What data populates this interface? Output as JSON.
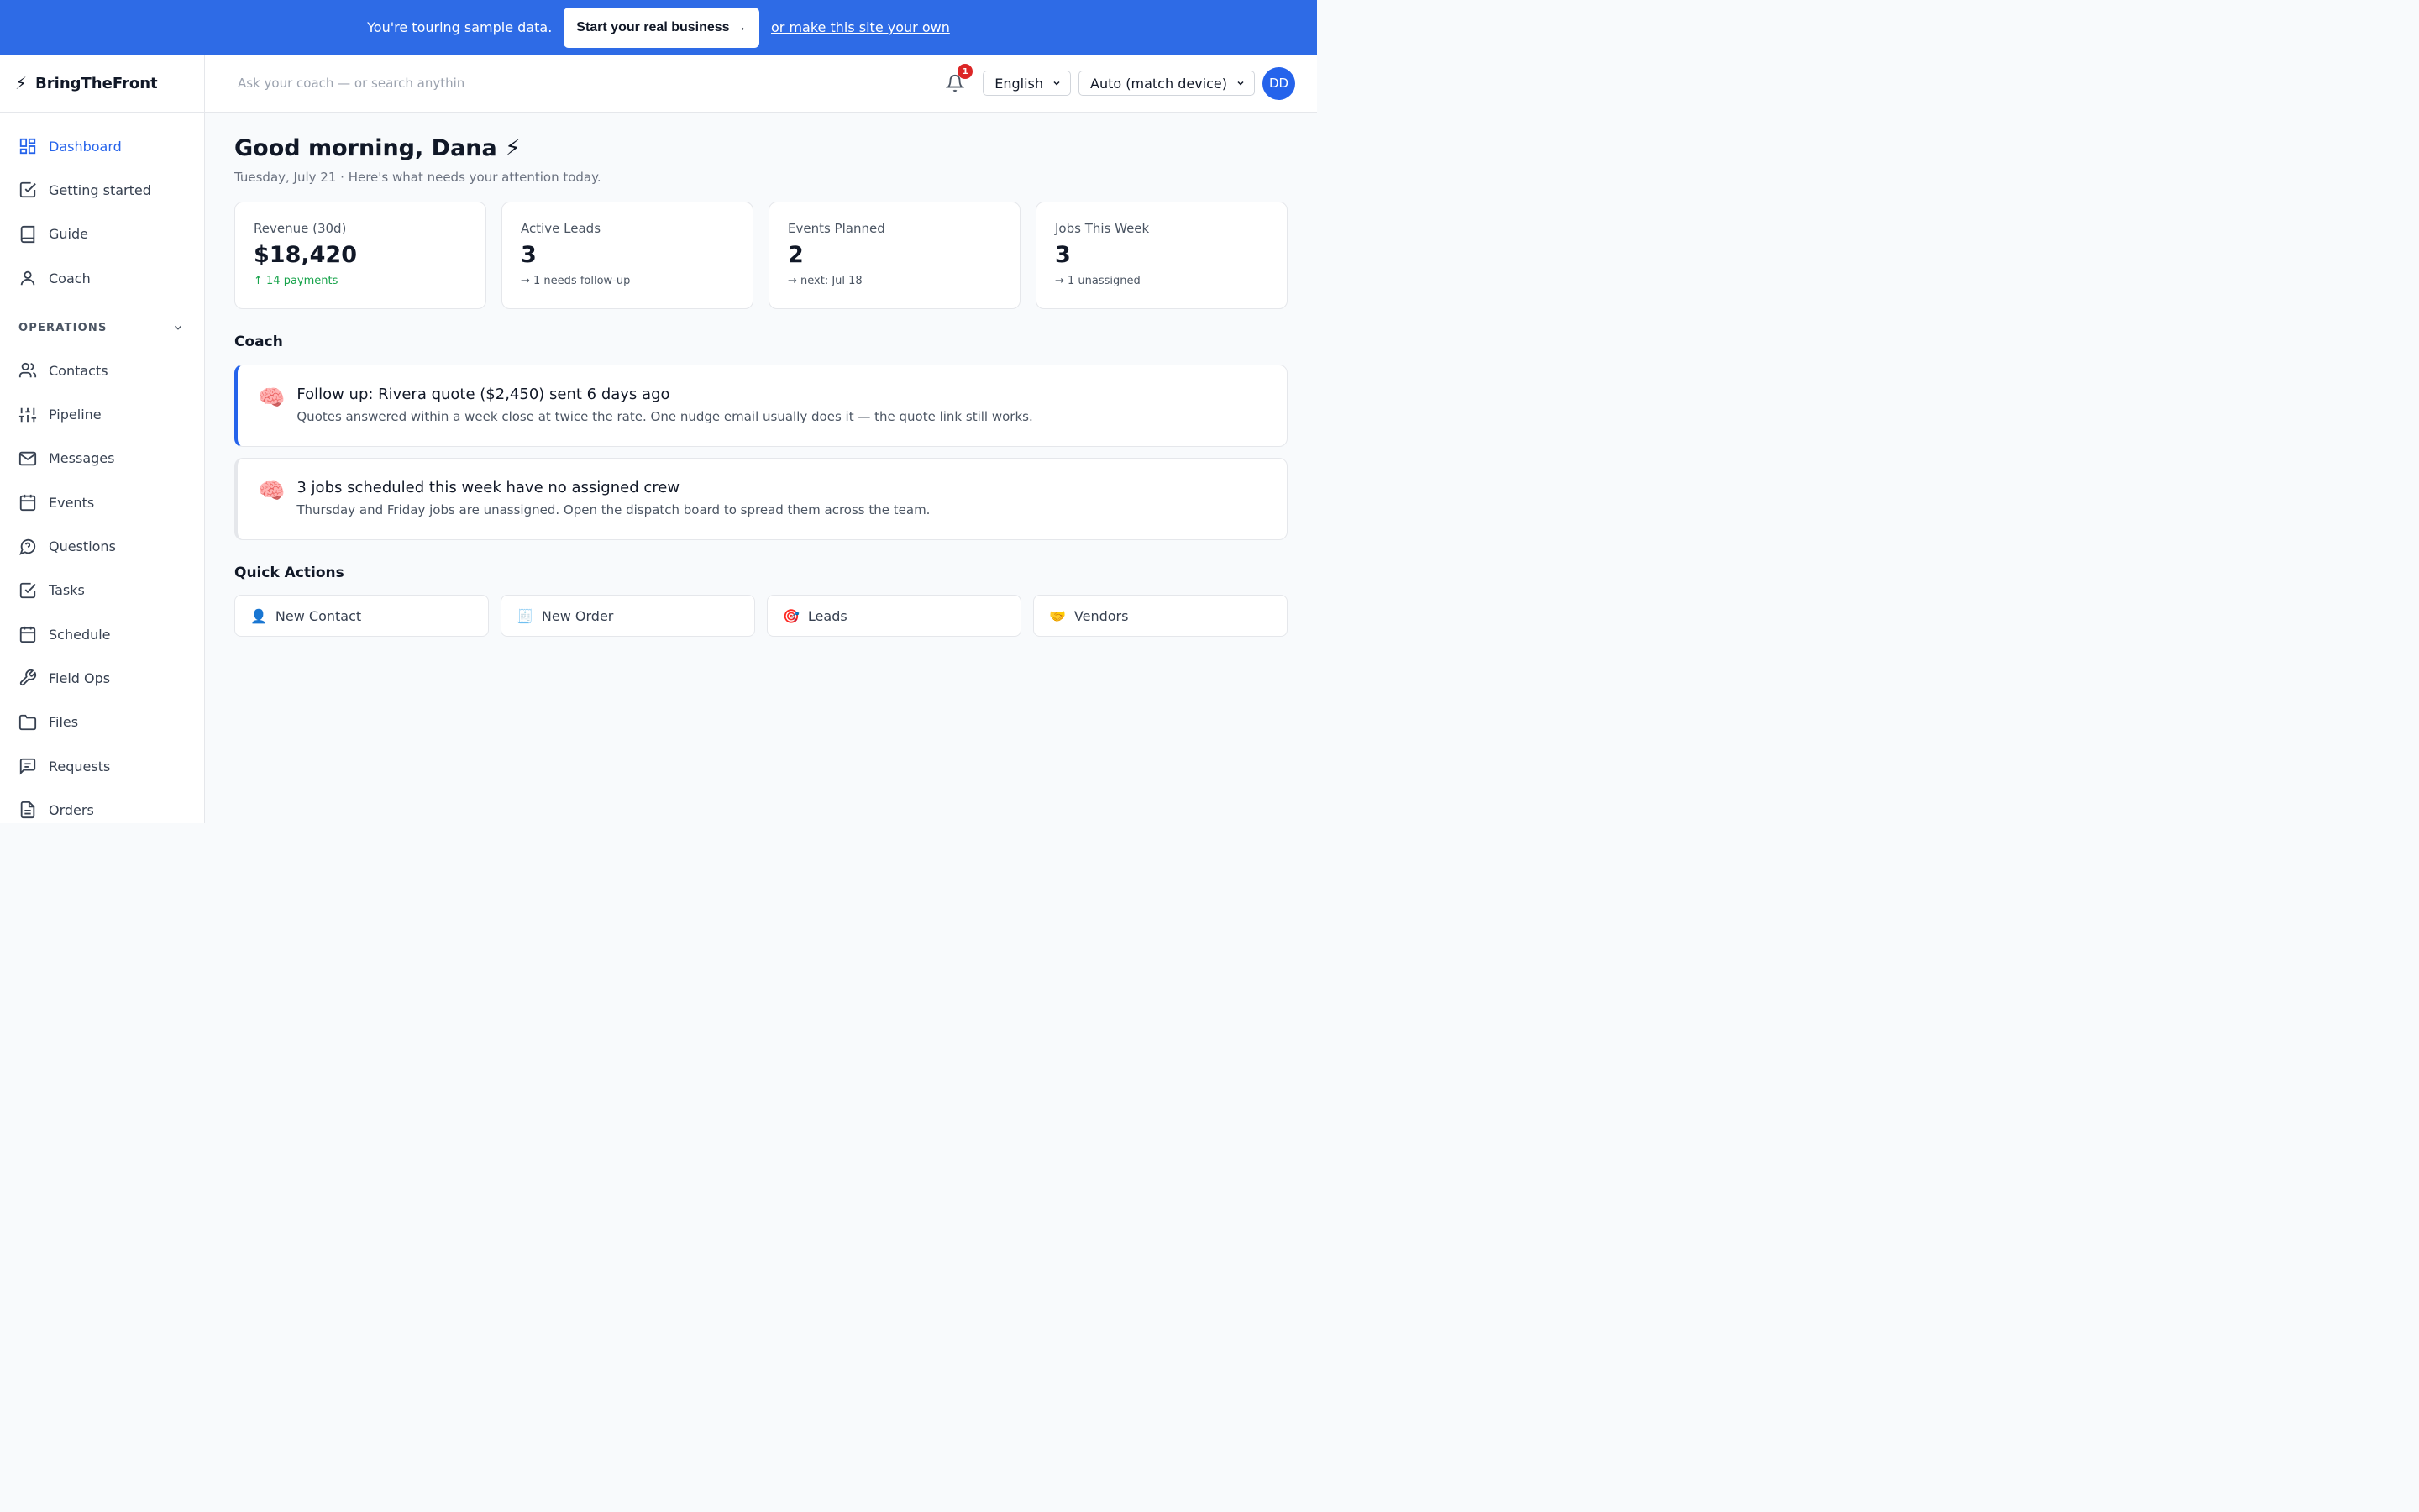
{
  "banner": {
    "text": "You're touring sample data.",
    "cta": "Start your real business →",
    "link": "or make this site your own"
  },
  "brand": {
    "icon": "⚡",
    "name": "BringTheFront"
  },
  "nav": {
    "top": [
      {
        "label": "Dashboard",
        "icon": "dashboard-icon"
      },
      {
        "label": "Getting started",
        "icon": "checkbox-icon"
      },
      {
        "label": "Guide",
        "icon": "book-icon"
      },
      {
        "label": "Coach",
        "icon": "user-icon"
      }
    ],
    "section_label": "OPERATIONS",
    "ops": [
      {
        "label": "Contacts",
        "icon": "users-icon"
      },
      {
        "label": "Pipeline",
        "icon": "sliders-icon"
      },
      {
        "label": "Messages",
        "icon": "mail-icon"
      },
      {
        "label": "Events",
        "icon": "calendar-icon"
      },
      {
        "label": "Questions",
        "icon": "help-icon"
      },
      {
        "label": "Tasks",
        "icon": "checkbox-icon"
      },
      {
        "label": "Schedule",
        "icon": "calendar-icon"
      },
      {
        "label": "Field Ops",
        "icon": "wrench-icon"
      },
      {
        "label": "Files",
        "icon": "folder-icon"
      },
      {
        "label": "Requests",
        "icon": "message-square-icon"
      },
      {
        "label": "Orders",
        "icon": "file-icon"
      }
    ]
  },
  "topbar": {
    "search_placeholder": "Ask your coach — or search anythin",
    "notification_count": "1",
    "language": "English",
    "theme": "Auto (match device)",
    "avatar_initials": "DD"
  },
  "greeting": {
    "title": "Good morning, Dana ⚡",
    "subtitle": "Tuesday, July 21 · Here's what needs your attention today."
  },
  "stats": [
    {
      "label": "Revenue (30d)",
      "value": "$18,420",
      "sub": "↑ 14 payments",
      "trend": "up"
    },
    {
      "label": "Active Leads",
      "value": "3",
      "sub": "→ 1 needs follow-up",
      "trend": "neutral"
    },
    {
      "label": "Events Planned",
      "value": "2",
      "sub": "→ next: Jul 18",
      "trend": "neutral"
    },
    {
      "label": "Jobs This Week",
      "value": "3",
      "sub": "→ 1 unassigned",
      "trend": "neutral"
    }
  ],
  "coach": {
    "title": "Coach",
    "cards": [
      {
        "emoji": "🧠",
        "heading": "Follow up: Rivera quote ($2,450) sent 6 days ago",
        "body": "Quotes answered within a week close at twice the rate. One nudge email usually does it — the quote link still works."
      },
      {
        "emoji": "🧠",
        "heading": "3 jobs scheduled this week have no assigned crew",
        "body": "Thursday and Friday jobs are unassigned. Open the dispatch board to spread them across the team."
      }
    ]
  },
  "quick_actions": {
    "title": "Quick Actions",
    "items": [
      {
        "emoji": "👤",
        "label": "New Contact"
      },
      {
        "emoji": "🧾",
        "label": "New Order"
      },
      {
        "emoji": "🎯",
        "label": "Leads"
      },
      {
        "emoji": "🤝",
        "label": "Vendors"
      }
    ]
  },
  "colors": {
    "banner": "#2e6be6",
    "accent": "#2563eb",
    "positive": "#16a34a",
    "badge": "#dc2626"
  }
}
